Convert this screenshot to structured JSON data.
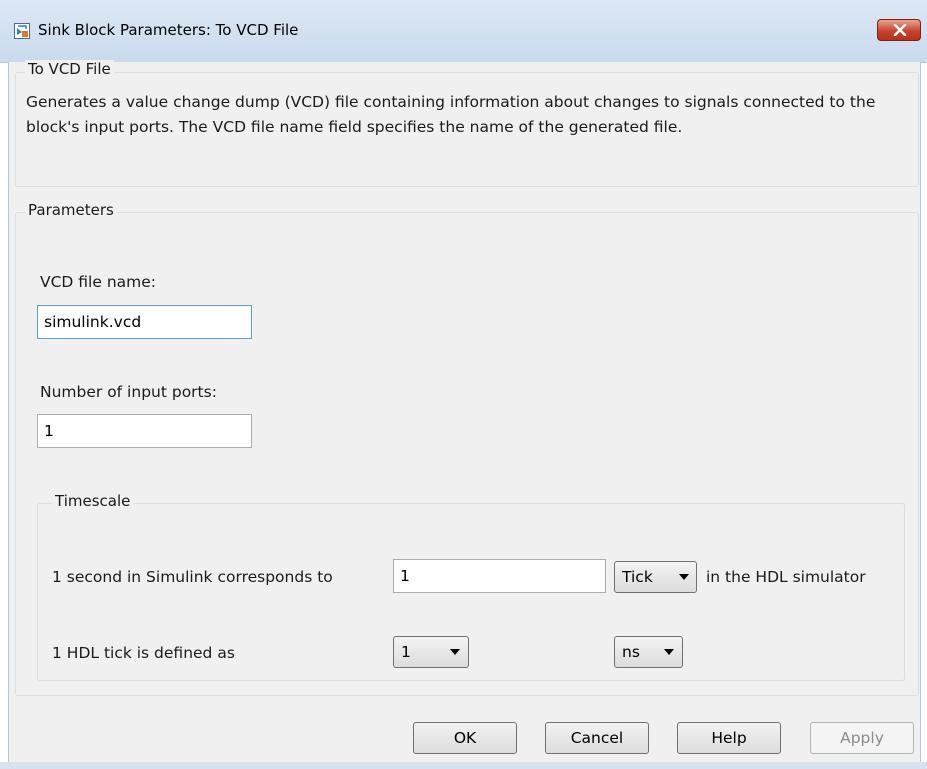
{
  "window": {
    "title": "Sink Block Parameters: To VCD File",
    "close_icon": "close-icon"
  },
  "description_group": {
    "label": "To VCD File",
    "text": "Generates a value change dump (VCD) file containing information about changes to signals connected to the block's input ports. The VCD file name field specifies the name of the generated file."
  },
  "parameters": {
    "label": "Parameters",
    "vcd_file_name_label": "VCD file name:",
    "vcd_file_name_value": "simulink.vcd",
    "num_ports_label": "Number of input ports:",
    "num_ports_value": "1"
  },
  "timescale": {
    "label": "Timescale",
    "row1_label": "1 second in Simulink corresponds to",
    "row1_value": "1",
    "row1_unit": "Tick",
    "row1_suffix": "in the HDL simulator",
    "row2_label": "1 HDL tick is defined as",
    "row2_value": "1",
    "row2_unit": "ns"
  },
  "buttons": {
    "ok": "OK",
    "cancel": "Cancel",
    "help": "Help",
    "apply": "Apply"
  },
  "colors": {
    "titlebar": "#c9daee",
    "close_button": "#c7442b",
    "dialog_bg": "#f0f0f0",
    "focus_border": "#569de5"
  }
}
